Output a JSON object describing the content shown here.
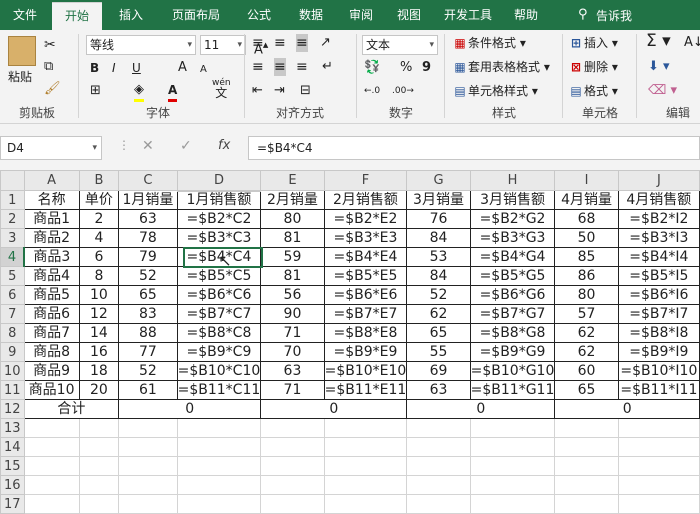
{
  "tabs": [
    {
      "label": "文件",
      "active": false
    },
    {
      "label": "开始",
      "active": true
    },
    {
      "label": "插入",
      "active": false
    },
    {
      "label": "页面布局",
      "active": false
    },
    {
      "label": "公式",
      "active": false
    },
    {
      "label": "数据",
      "active": false
    },
    {
      "label": "审阅",
      "active": false
    },
    {
      "label": "视图",
      "active": false
    },
    {
      "label": "开发工具",
      "active": false
    },
    {
      "label": "帮助",
      "active": false
    }
  ],
  "tell_me": "告诉我",
  "ribbon": {
    "clipboard": {
      "paste": "粘贴",
      "label": "剪贴板"
    },
    "font": {
      "name": "等线",
      "size": "11",
      "bold": "B",
      "italic": "I",
      "underline": "U",
      "grow": "A",
      "shrink": "A",
      "label": "字体",
      "wen": "wén",
      "wen_char": "文"
    },
    "alignment": {
      "label": "对齐方式"
    },
    "number": {
      "format": "文本",
      "percent": "%",
      "comma": "9",
      "label": "数字"
    },
    "styles": {
      "conditional": "条件格式",
      "table": "套用表格格式",
      "cell": "单元格样式",
      "label": "样式"
    },
    "cells": {
      "insert": "插入",
      "delete": "删除",
      "format": "格式",
      "label": "单元格"
    },
    "editing": {
      "label": "编辑"
    }
  },
  "formula_bar": {
    "name_box": "D4",
    "fx": "fx",
    "formula": "=$B4*C4"
  },
  "sheet": {
    "columns": [
      "A",
      "B",
      "C",
      "D",
      "E",
      "F",
      "G",
      "H",
      "I",
      "J"
    ],
    "selected_cell": "D4",
    "rows": [
      {
        "n": "1",
        "cells": [
          "名称",
          "单价",
          "1月销量",
          "1月销售额",
          "2月销量",
          "2月销售额",
          "3月销量",
          "3月销售额",
          "4月销量",
          "4月销售额"
        ]
      },
      {
        "n": "2",
        "cells": [
          "商品1",
          "2",
          "63",
          "=$B2*C2",
          "80",
          "=$B2*E2",
          "76",
          "=$B2*G2",
          "68",
          "=$B2*I2"
        ]
      },
      {
        "n": "3",
        "cells": [
          "商品2",
          "4",
          "78",
          "=$B3*C3",
          "81",
          "=$B3*E3",
          "84",
          "=$B3*G3",
          "50",
          "=$B3*I3"
        ]
      },
      {
        "n": "4",
        "cells": [
          "商品3",
          "6",
          "79",
          "=$B4*C4",
          "59",
          "=$B4*E4",
          "53",
          "=$B4*G4",
          "85",
          "=$B4*I4"
        ]
      },
      {
        "n": "5",
        "cells": [
          "商品4",
          "8",
          "52",
          "=$B5*C5",
          "81",
          "=$B5*E5",
          "84",
          "=$B5*G5",
          "86",
          "=$B5*I5"
        ]
      },
      {
        "n": "6",
        "cells": [
          "商品5",
          "10",
          "65",
          "=$B6*C6",
          "56",
          "=$B6*E6",
          "52",
          "=$B6*G6",
          "80",
          "=$B6*I6"
        ]
      },
      {
        "n": "7",
        "cells": [
          "商品6",
          "12",
          "83",
          "=$B7*C7",
          "90",
          "=$B7*E7",
          "62",
          "=$B7*G7",
          "57",
          "=$B7*I7"
        ]
      },
      {
        "n": "8",
        "cells": [
          "商品7",
          "14",
          "88",
          "=$B8*C8",
          "71",
          "=$B8*E8",
          "65",
          "=$B8*G8",
          "62",
          "=$B8*I8"
        ]
      },
      {
        "n": "9",
        "cells": [
          "商品8",
          "16",
          "77",
          "=$B9*C9",
          "70",
          "=$B9*E9",
          "55",
          "=$B9*G9",
          "62",
          "=$B9*I9"
        ]
      },
      {
        "n": "10",
        "cells": [
          "商品9",
          "18",
          "52",
          "=$B10*C10",
          "63",
          "=$B10*E10",
          "69",
          "=$B10*G10",
          "60",
          "=$B10*I10"
        ]
      },
      {
        "n": "11",
        "cells": [
          "商品10",
          "20",
          "61",
          "=$B11*C11",
          "71",
          "=$B11*E11",
          "63",
          "=$B11*G11",
          "65",
          "=$B11*I11"
        ]
      }
    ],
    "total_row": {
      "n": "12",
      "label": "合计",
      "values": [
        "0",
        "0",
        "0",
        "0"
      ]
    },
    "empty_rows": [
      "13",
      "14",
      "15",
      "16",
      "17"
    ]
  }
}
